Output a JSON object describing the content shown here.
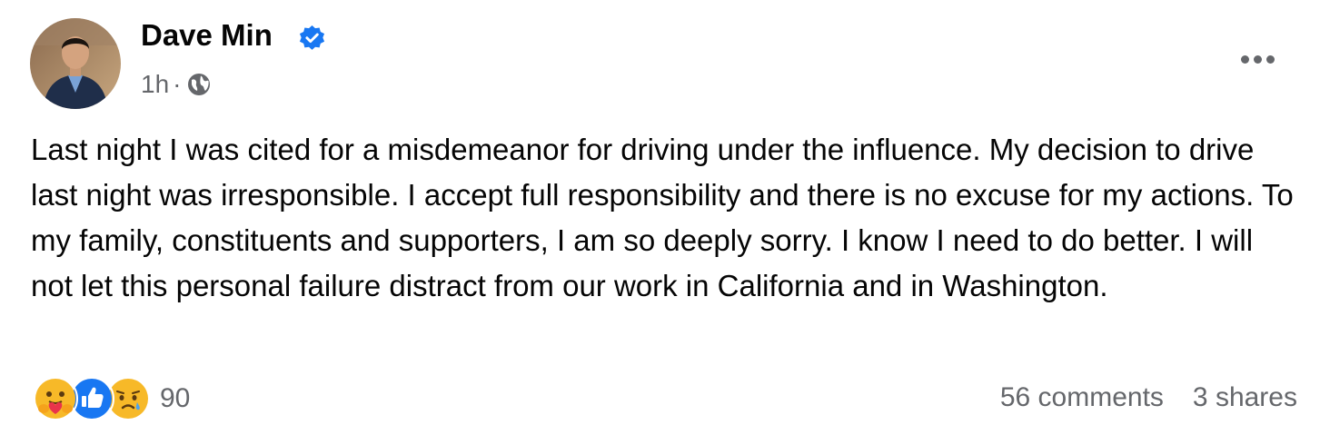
{
  "post": {
    "author": "Dave Min",
    "time": "1h",
    "separator": "·",
    "privacy_icon": "globe-icon",
    "verified_icon": "verified-badge-icon",
    "more_icon": "more-options-icon",
    "text": "Last night I was cited for a misdemeanor for driving under the influence. My decision to drive last night was irresponsible. I accept full responsibility and there is no excuse for my actions. To my family, constituents and supporters, I am so deeply sorry. I know I need to do better. I will not let this personal failure distract from our work in California and in Washington."
  },
  "reactions": {
    "icons": [
      "care-reaction-icon",
      "like-reaction-icon",
      "sad-reaction-icon"
    ],
    "count": "90"
  },
  "stats": {
    "comments": "56 comments",
    "shares": "3 shares"
  },
  "colors": {
    "verified": "#1877f2",
    "like": "#1877f2",
    "secondary_text": "#65676b"
  }
}
